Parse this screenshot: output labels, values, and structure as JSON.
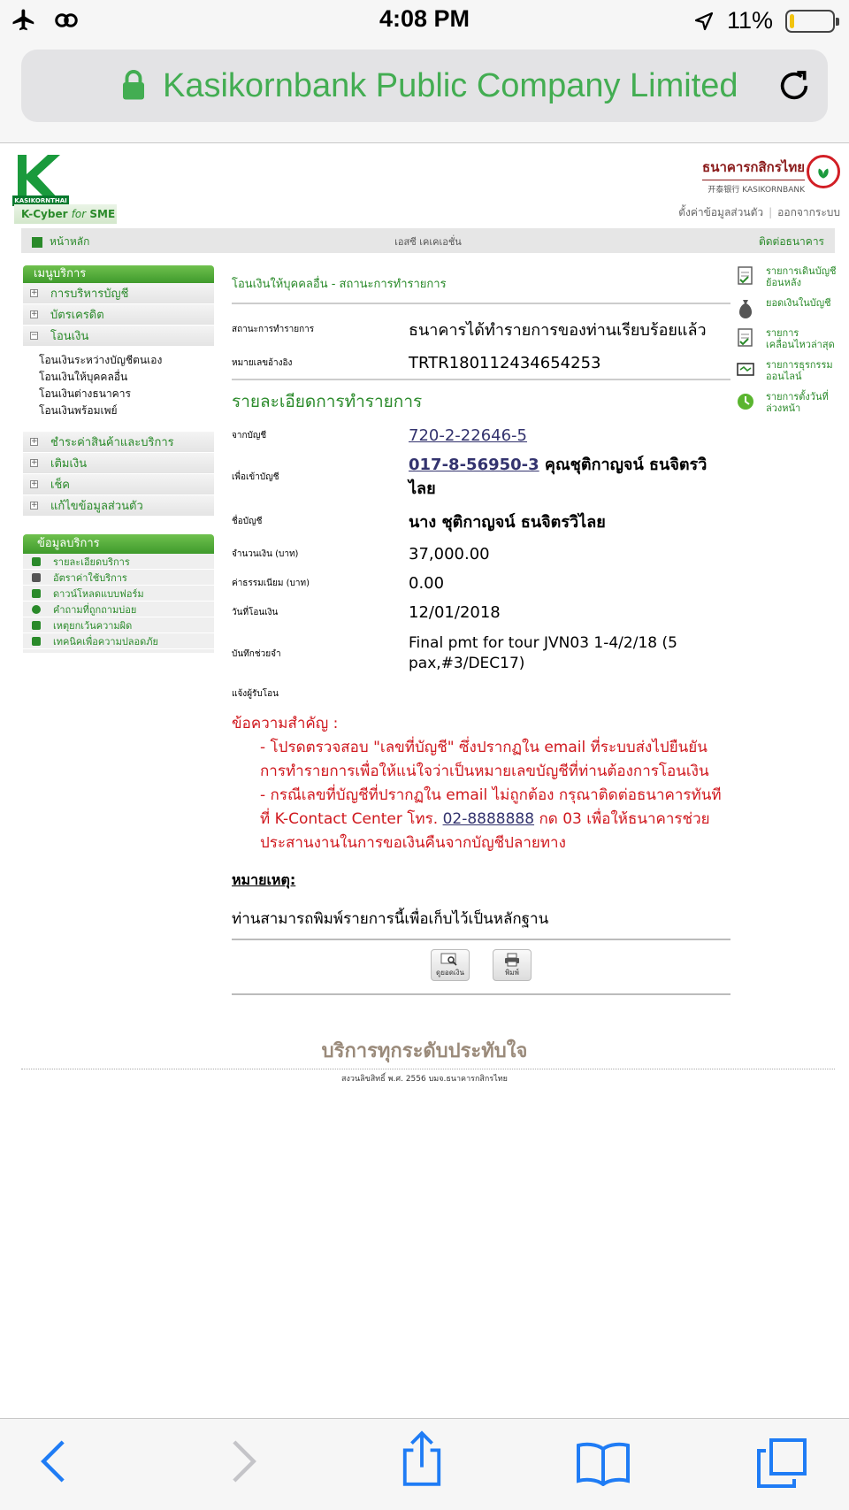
{
  "status_bar": {
    "time": "4:08 PM",
    "battery": "11%",
    "battery_level": 0.11
  },
  "browser": {
    "url_text": "Kasikornbank Public Company Limited"
  },
  "header": {
    "logo_text": "KASIKORNTHAI",
    "kcyber_prefix": "K-Cyber ",
    "kcyber_for": "for",
    "kcyber_suffix": " SME",
    "bank_name_th": "ธนาคารกสิกรไทย",
    "bank_name_en": "开泰银行 KASIKORNBANK",
    "link_settings": "ตั้งค่าข้อมูลส่วนตัว",
    "link_logout": "ออกจากระบบ"
  },
  "navbar": {
    "home": "หน้าหลัก",
    "middle": "เอสซี เคเคเอชั่น",
    "contact": "ติดต่อธนาคาร"
  },
  "sidebar": {
    "menu_title": "เมนูบริการ",
    "items_top": [
      {
        "label": "การบริหารบัญชี",
        "sign": "+"
      },
      {
        "label": "บัตรเครดิต",
        "sign": "+"
      },
      {
        "label": "โอนเงิน",
        "sign": "−"
      }
    ],
    "submenu": [
      "โอนเงินระหว่างบัญชีตนเอง",
      "โอนเงินให้บุคคลอื่น",
      "โอนเงินต่างธนาคาร",
      "โอนเงินพร้อมเพย์"
    ],
    "items_bottom": [
      {
        "label": "ชำระค่าสินค้าและบริการ",
        "sign": "+"
      },
      {
        "label": "เติมเงิน",
        "sign": "+"
      },
      {
        "label": "เช็ค",
        "sign": "+"
      },
      {
        "label": "แก้ไขข้อมูลส่วนตัว",
        "sign": "+"
      }
    ],
    "service_title": "ข้อมูลบริการ",
    "service_items": [
      "รายละเอียดบริการ",
      "อัตราค่าใช้บริการ",
      "ดาวน์โหลดแบบฟอร์ม",
      "คำถามที่ถูกถามบ่อย",
      "เหตุยกเว้นความผิด",
      "เทคนิคเพื่อความปลอดภัย"
    ]
  },
  "main": {
    "page_title": "โอนเงินให้บุคคลอื่น - สถานะการทำรายการ",
    "status_label": "สถานะการทำรายการ",
    "status_value": "ธนาคารได้ทำรายการของท่านเรียบร้อยแล้ว",
    "ref_label": "หมายเลขอ้างอิง",
    "ref_value": "TRTR180112434654253",
    "section_title": "รายละเอียดการทำรายการ",
    "from_label": "จากบัญชี",
    "from_value": "720-2-22646-5",
    "to_label": "เพื่อเข้าบัญชี",
    "to_account": "017-8-56950-3",
    "to_name": " คุณชุติกาญจน์ ธนจิตรวิไลย",
    "name_label": "ชื่อบัญชี",
    "name_value": "นาง ชุติกาญจน์ ธนจิตรวิไลย",
    "amount_label": "จำนวนเงิน (บาท)",
    "amount_value": "37,000.00",
    "fee_label": "ค่าธรรมเนียม (บาท)",
    "fee_value": "0.00",
    "date_label": "วันที่โอนเงิน",
    "date_value": "12/01/2018",
    "memo_label": "บันทึกช่วยจำ",
    "memo_value": "Final pmt for tour JVN03 1-4/2/18 (5 pax,#3/DEC17)",
    "notify_label": "แจ้งผู้รับโอน",
    "warning_title": "ข้อความสำคัญ :",
    "warning_1": "- โปรดตรวจสอบ \"เลขที่บัญชี\" ซึ่งปรากฏใน email ที่ระบบส่งไปยืนยันการทำรายการเพื่อให้แน่ใจว่าเป็นหมายเลขบัญชีที่ท่านต้องการโอนเงิน",
    "warning_2a": "- กรณีเลขที่บัญชีที่ปรากฏใน email ไม่ถูกต้อง กรุณาติดต่อธนาคารทันทีที่ K-Contact Center โทร. ",
    "warning_phone": "02-8888888",
    "warning_2b": " กด 03 เพื่อให้ธนาคารช่วยประสานงานในการขอเงินคืนจากบัญชีปลายทาง",
    "note_title": "หมายเหตุ:",
    "note_text": "ท่านสามารถพิมพ์รายการนี้เพื่อเก็บไว้เป็นหลักฐาน",
    "btn_balance": "ดูยอดเงิน",
    "btn_print": "พิมพ์"
  },
  "right_links": [
    "รายการเดินบัญชีย้อนหลัง",
    "ยอดเงินในบัญชี",
    "รายการเคลื่อนไหวล่าสุด",
    "รายการธุรกรรมออนไลน์",
    "รายการตั้งวันที่ล่วงหน้า"
  ],
  "footer": {
    "slogan": "บริการทุกระดับประทับใจ",
    "copyright": "สงวนลิขสิทธิ์ พ.ศ. 2556 บมจ.ธนาคารกสิกรไทย"
  },
  "colors": {
    "brand_green": "#2a8a2a",
    "url_green": "#43ad52",
    "warning_red": "#d0181e",
    "ios_blue": "#1f7cf5"
  }
}
